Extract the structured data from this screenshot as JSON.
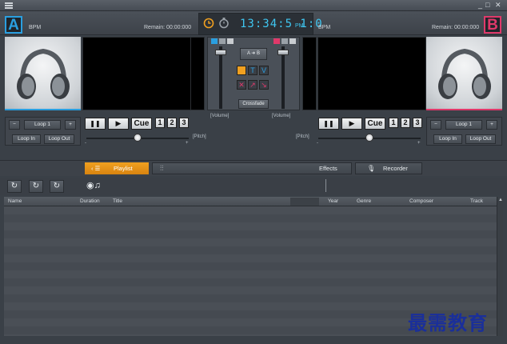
{
  "window": {
    "minimize": "_",
    "maximize": "□",
    "close": "✕"
  },
  "deck_a": {
    "letter": "A",
    "bpm_label": "BPM",
    "remain": "Remain: 00:00:000",
    "loop_label": "Loop 1",
    "loop_minus": "−",
    "loop_plus": "+",
    "loop_in": "Loop In",
    "loop_out": "Loop Out",
    "pause": "❚❚",
    "play": "▶",
    "cue": "Cue",
    "hotcues": [
      "1",
      "2",
      "3"
    ],
    "volume_label": "[Volume]",
    "pitch_label": "[Pitch]",
    "pitch_minus": "-",
    "pitch_plus": "+",
    "accent": "#2a9fe0"
  },
  "deck_b": {
    "letter": "B",
    "bpm_label": "BPM",
    "remain": "Remain: 00:00:000",
    "loop_label": "Loop 1",
    "loop_minus": "−",
    "loop_plus": "+",
    "loop_in": "Loop In",
    "loop_out": "Loop Out",
    "pause": "❚❚",
    "play": "▶",
    "cue": "Cue",
    "hotcues": [
      "1",
      "2",
      "3"
    ],
    "volume_label": "[Volume]",
    "pitch_label": "[Pitch]",
    "pitch_minus": "-",
    "pitch_plus": "+",
    "accent": "#e0396a"
  },
  "clock": {
    "time": "13:34:5 1:0",
    "ampm": "PM"
  },
  "mixer": {
    "a_to_b": "A ➜ B",
    "crossfade": "Crossfade"
  },
  "tabs": {
    "playlist": "Playlist",
    "effects": "Effects",
    "recorder": "Recorder"
  },
  "table": {
    "columns": [
      "Name",
      "Duration",
      "Title",
      "Year",
      "Genre",
      "Composer",
      "Track"
    ]
  },
  "watermark": "最需教育"
}
